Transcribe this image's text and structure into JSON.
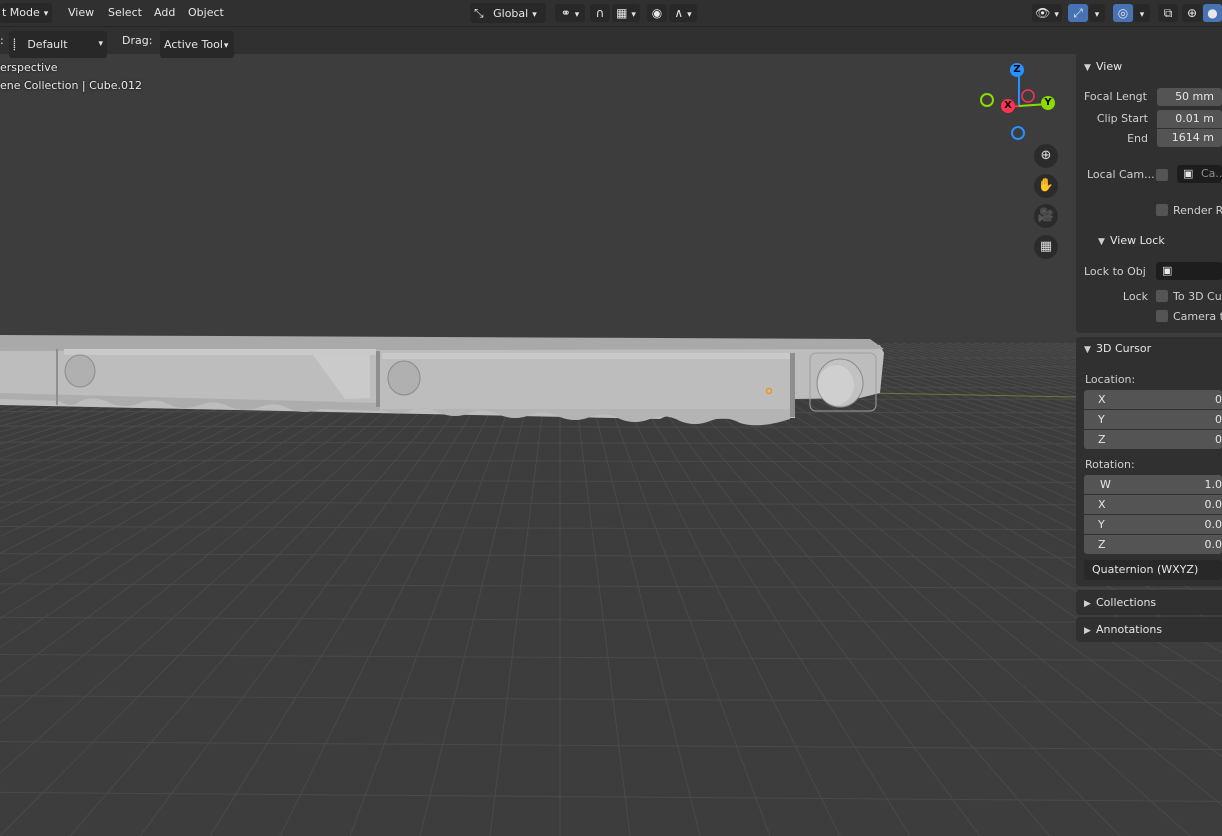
{
  "header": {
    "mode_label": "t Mode",
    "menus": [
      "View",
      "Select",
      "Add",
      "Object"
    ],
    "transform_orientation": "Global",
    "icons": [
      "transform-pivot-icon",
      "link-icon",
      "snap-magnet-icon",
      "snap-grid-icon",
      "proportional-edit-icon",
      "falloff-curve-icon",
      "visibility-eye-icon",
      "gizmo-arrow-icon",
      "overlay-icon",
      "xray-icon",
      "shading-wireframe-icon",
      "shading-solid-icon"
    ]
  },
  "toolbar": {
    "orient_prefix": ":",
    "orient_value": "Default",
    "drag_label": "Drag:",
    "drag_value": "Active Tool"
  },
  "viewport": {
    "view_name": "erspective",
    "collection_info": "ene Collection | Cube.012",
    "gizmo": {
      "z": "Z",
      "x": "X",
      "y": "Y"
    }
  },
  "sidebar": {
    "view": {
      "title": "View",
      "focal_label": "Focal Lengt",
      "focal_value": "50 mm",
      "clip_start_label": "Clip Start",
      "clip_start_value": "0.01 m",
      "end_label": "End",
      "end_value": "1614 m",
      "local_cam_label": "Local Cam...",
      "local_cam_value": "Ca...",
      "render_region_label": "Render Re"
    },
    "view_lock": {
      "title": "View Lock",
      "lock_to_obj_label": "Lock to Obj",
      "lock_label": "Lock",
      "to_cursor_label": "To 3D Cur",
      "camera_to_label": "Camera to"
    },
    "cursor": {
      "title": "3D Cursor",
      "location_label": "Location:",
      "location": [
        {
          "axis": "X",
          "value": "0"
        },
        {
          "axis": "Y",
          "value": "0"
        },
        {
          "axis": "Z",
          "value": "0"
        }
      ],
      "rotation_label": "Rotation:",
      "rotation": [
        {
          "axis": "W",
          "value": "1.0"
        },
        {
          "axis": "X",
          "value": "0.0"
        },
        {
          "axis": "Y",
          "value": "0.0"
        },
        {
          "axis": "Z",
          "value": "0.0"
        }
      ],
      "rotation_mode": "Quaternion (WXYZ)"
    },
    "collections_title": "Collections",
    "annotations_title": "Annotations"
  },
  "colors": {
    "accent": "#4772b3",
    "axis_x": "#ff3352",
    "axis_y": "#8bdc00",
    "axis_z": "#2890ff",
    "object_gray": "#bcbcbc"
  }
}
